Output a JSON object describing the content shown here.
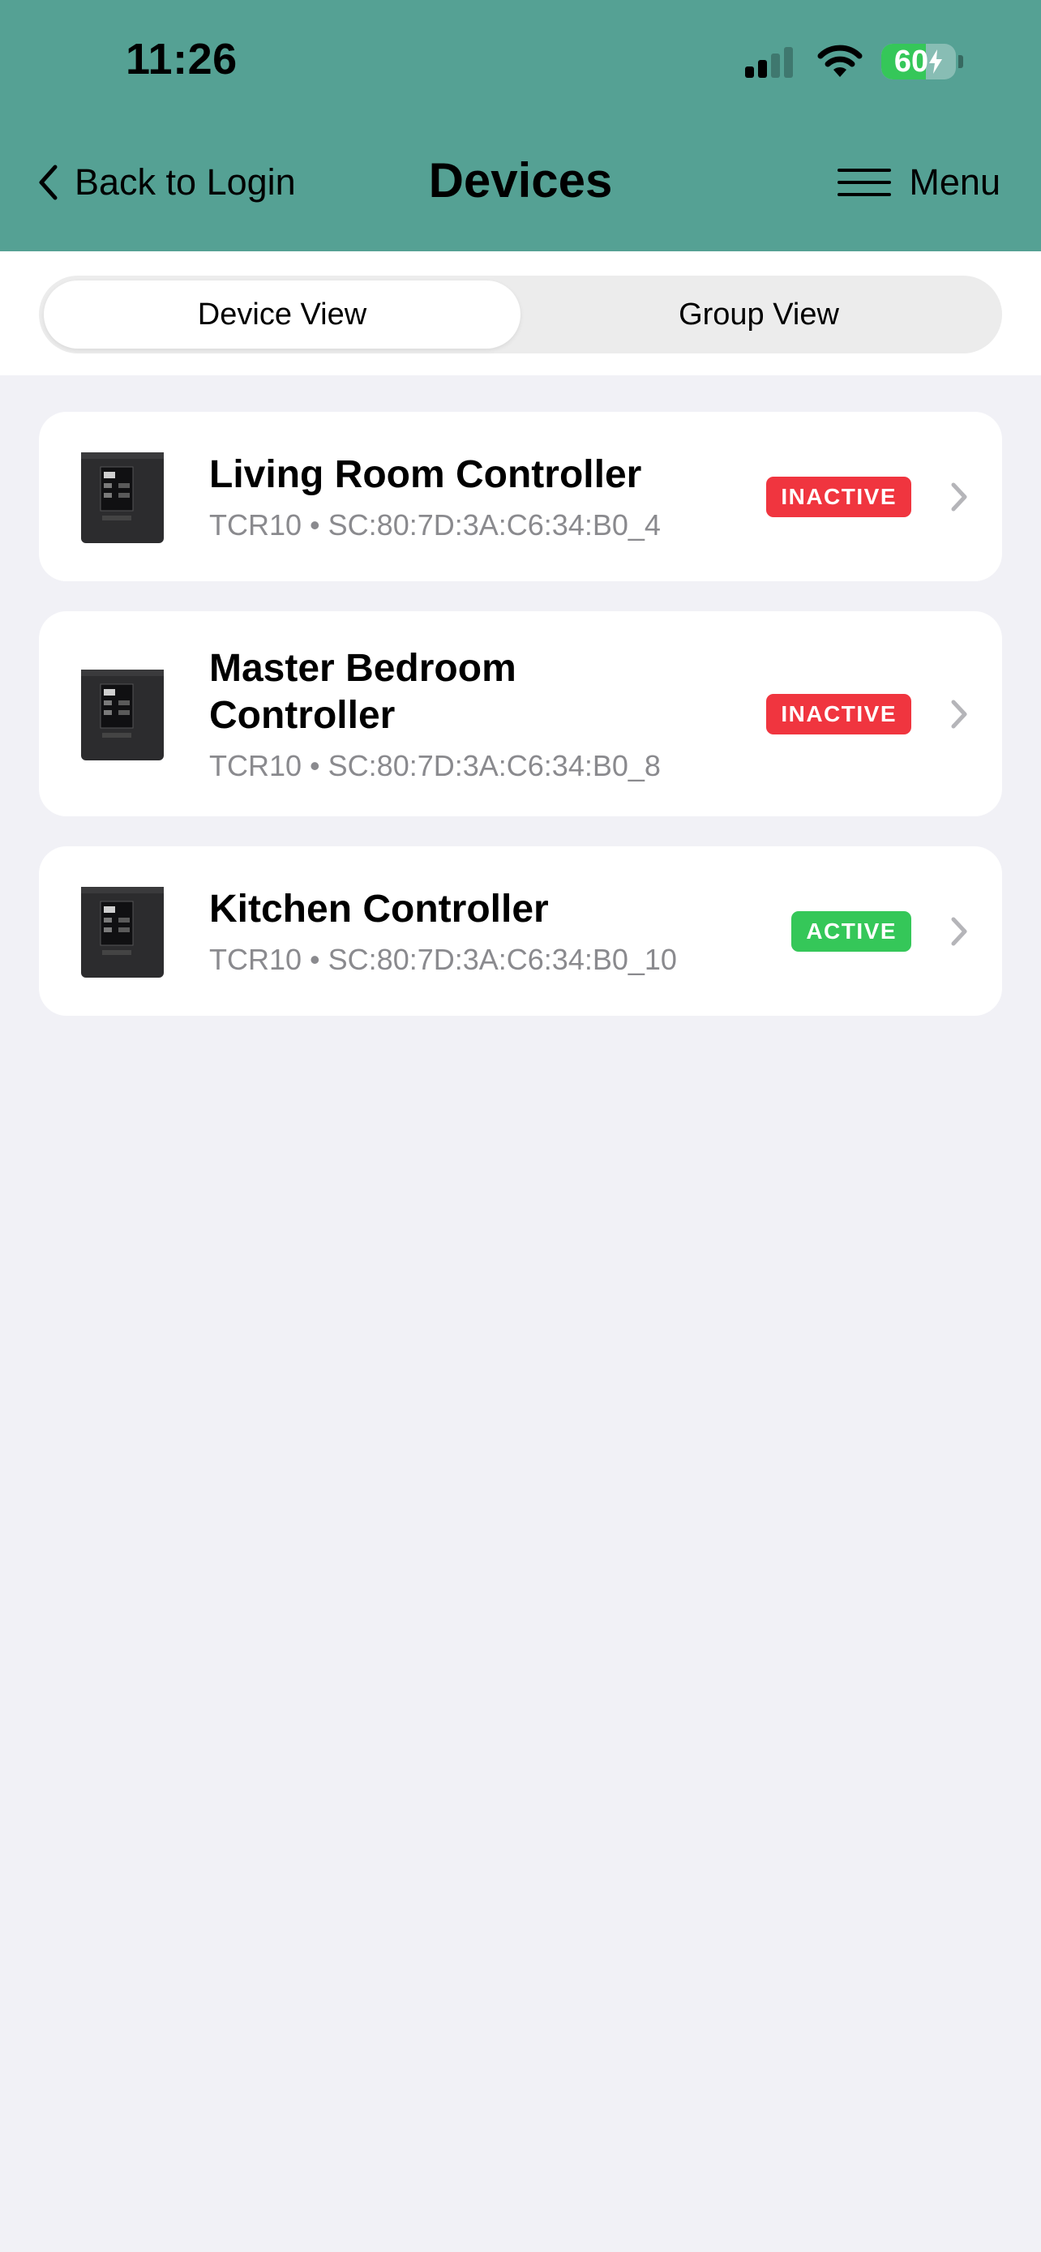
{
  "status_bar": {
    "time": "11:26",
    "battery_level": "60",
    "battery_color": "#35c759"
  },
  "nav": {
    "back_label": "Back to Login",
    "title": "Devices",
    "menu_label": "Menu",
    "back_icon": "chevron-left-icon",
    "menu_icon": "hamburger-icon"
  },
  "segments": {
    "device_view": "Device View",
    "group_view": "Group View",
    "selected": "Device View"
  },
  "colors": {
    "header": "#55a194",
    "inactive": "#f0353f",
    "active": "#35c759"
  },
  "devices": [
    {
      "name": "Living Room Controller",
      "model": "TCR10",
      "address": "SC:80:7D:3A:C6:34:B0_4",
      "status": "INACTIVE"
    },
    {
      "name": "Master Bedroom Controller",
      "model": "TCR10",
      "address": "SC:80:7D:3A:C6:34:B0_8",
      "status": "INACTIVE"
    },
    {
      "name": "Kitchen Controller",
      "model": "TCR10",
      "address": "SC:80:7D:3A:C6:34:B0_10",
      "status": "ACTIVE"
    }
  ]
}
